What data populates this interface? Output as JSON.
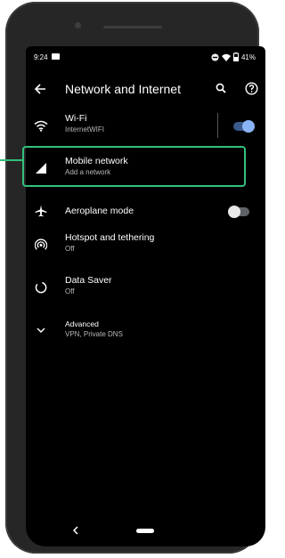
{
  "status_bar": {
    "time": "9:24",
    "battery": "41%"
  },
  "app_bar": {
    "title": "Network and Internet"
  },
  "items": [
    {
      "id": "wifi",
      "label": "Wi-Fi",
      "subtitle": "InternetWIFI",
      "icon": "wifi-icon",
      "toggle": "on"
    },
    {
      "id": "mobile",
      "label": "Mobile network",
      "subtitle": "Add a network",
      "icon": "cell-signal-icon"
    },
    {
      "id": "aeroplane",
      "label": "Aeroplane mode",
      "subtitle": "",
      "icon": "airplane-icon",
      "toggle": "off"
    },
    {
      "id": "hotspot",
      "label": "Hotspot and tethering",
      "subtitle": "Off",
      "icon": "hotspot-icon"
    },
    {
      "id": "datasaver",
      "label": "Data Saver",
      "subtitle": "Off",
      "icon": "data-saver-icon"
    },
    {
      "id": "advanced",
      "label": "Advanced",
      "subtitle": "VPN, Private DNS",
      "icon": "chevron-down-icon"
    }
  ],
  "colors": {
    "accent": "#8ab4f8",
    "toggle_track_on": "#3a5a8c",
    "highlight": "#33c07a"
  },
  "nav": {
    "back_icon": "nav-back-icon",
    "home_icon": "nav-home-pill"
  }
}
